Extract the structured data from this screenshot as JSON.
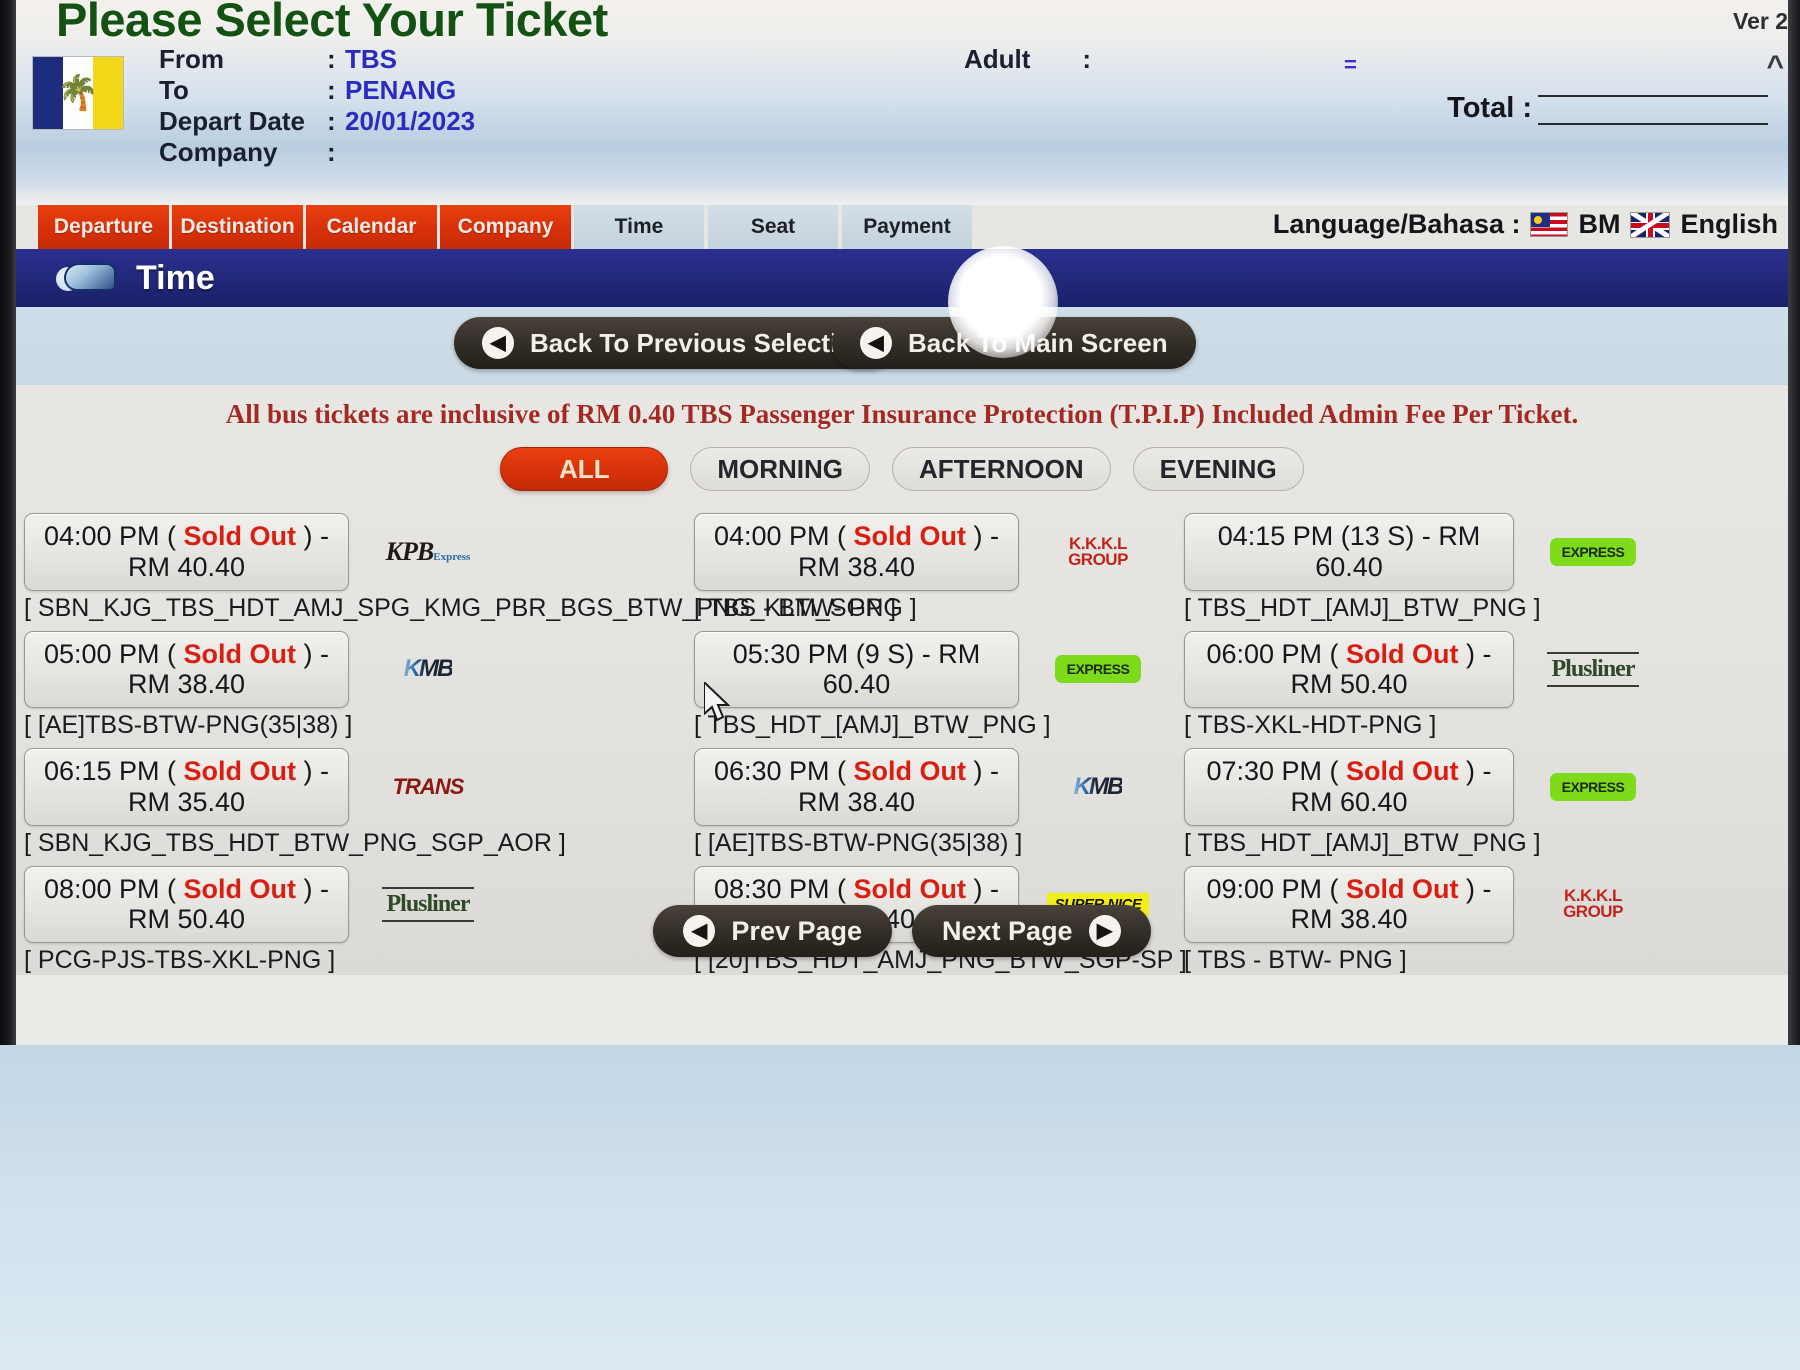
{
  "header": {
    "page_title": "Please Select Your Ticket",
    "version": "Ver 2",
    "fields": [
      {
        "label": "From",
        "colon": ":",
        "value": "TBS"
      },
      {
        "label": "To",
        "colon": ":",
        "value": "PENANG"
      },
      {
        "label": "Depart Date",
        "colon": ":",
        "value": "20/01/2023"
      },
      {
        "label": "Company",
        "colon": ":",
        "value": ""
      }
    ],
    "adult_label": "Adult",
    "adult_colon": ":",
    "adult_value": "=",
    "total_label": "Total :",
    "total_value": ""
  },
  "tabs": [
    {
      "label": "Departure",
      "state": "done"
    },
    {
      "label": "Destination",
      "state": "done"
    },
    {
      "label": "Calendar",
      "state": "done"
    },
    {
      "label": "Company",
      "state": "done"
    },
    {
      "label": "Time",
      "state": "pending"
    },
    {
      "label": "Seat",
      "state": "pending"
    },
    {
      "label": "Payment",
      "state": "pending"
    }
  ],
  "language": {
    "label": "Language/Bahasa :",
    "bm_label": "BM",
    "english_label": "English"
  },
  "section": {
    "title": "Time",
    "icon": "bus-icon"
  },
  "nav_buttons": {
    "back_previous": "Back To Previous Selection",
    "back_main": "Back To Main Screen"
  },
  "notice": "All bus tickets are inclusive of RM 0.40 TBS Passenger Insurance Protection (T.P.I.P) Included Admin Fee Per Ticket.",
  "filters": [
    {
      "label": "ALL",
      "active": true
    },
    {
      "label": "MORNING",
      "active": false
    },
    {
      "label": "AFTERNOON",
      "active": false
    },
    {
      "label": "EVENING",
      "active": false
    }
  ],
  "trip_columns": [
    {
      "trips": [
        {
          "time": "04:00 PM",
          "status": "Sold Out",
          "sold_out": true,
          "currency": "RM",
          "price": "40.40",
          "route": "[ SBN_KJG_TBS_HDT_AMJ_SPG_KMG_PBR_BGS_BTW_PNG_KLM_SGP ]",
          "operator": "KPB Express",
          "logo": "kpb"
        },
        {
          "time": "05:00 PM",
          "status": "Sold Out",
          "sold_out": true,
          "currency": "RM",
          "price": "38.40",
          "route": "[ [AE]TBS-BTW-PNG(35|38) ]",
          "operator": "KMB",
          "logo": "kmb"
        },
        {
          "time": "06:15 PM",
          "status": "Sold Out",
          "sold_out": true,
          "currency": "RM",
          "price": "35.40",
          "route": "[ SBN_KJG_TBS_HDT_BTW_PNG_SGP_AOR ]",
          "operator": "Transnasional Express",
          "logo": "trans"
        },
        {
          "time": "08:00 PM",
          "status": "Sold Out",
          "sold_out": true,
          "currency": "RM",
          "price": "50.40",
          "route": "[ PCG-PJS-TBS-XKL-PNG ]",
          "operator": "Plusliner",
          "logo": "plusliner"
        }
      ]
    },
    {
      "trips": [
        {
          "time": "04:00 PM",
          "status": "Sold Out",
          "sold_out": true,
          "currency": "RM",
          "price": "38.40",
          "route": "[ TBS - BTW- PNG ]",
          "operator": "K.K.K.L Group",
          "logo": "kkkl"
        },
        {
          "time": "05:30 PM",
          "status": "9 S",
          "sold_out": false,
          "currency": "RM",
          "price": "60.40",
          "route": "[ TBS_HDT_[AMJ]_BTW_PNG ]",
          "operator": "Green Express",
          "logo": "green"
        },
        {
          "time": "06:30 PM",
          "status": "Sold Out",
          "sold_out": true,
          "currency": "RM",
          "price": "38.40",
          "route": "[ [AE]TBS-BTW-PNG(35|38) ]",
          "operator": "KMB",
          "logo": "kmb"
        },
        {
          "time": "08:30 PM",
          "status": "Sold Out",
          "sold_out": true,
          "currency": "RM",
          "price": "53.40",
          "route": "[ [20]TBS_HDT_AMJ_PNG_BTW_SGP-SP ]",
          "operator": "Super Nice",
          "logo": "supernice"
        }
      ]
    },
    {
      "trips": [
        {
          "time": "04:15 PM",
          "status": "13 S",
          "sold_out": false,
          "currency": "RM",
          "price": "60.40",
          "route": "[ TBS_HDT_[AMJ]_BTW_PNG ]",
          "operator": "Green Express",
          "logo": "green"
        },
        {
          "time": "06:00 PM",
          "status": "Sold Out",
          "sold_out": true,
          "currency": "RM",
          "price": "50.40",
          "route": "[ TBS-XKL-HDT-PNG ]",
          "operator": "Plusliner",
          "logo": "plusliner"
        },
        {
          "time": "07:30 PM",
          "status": "Sold Out",
          "sold_out": true,
          "currency": "RM",
          "price": "60.40",
          "route": "[ TBS_HDT_[AMJ]_BTW_PNG ]",
          "operator": "Green Express",
          "logo": "green"
        },
        {
          "time": "09:00 PM",
          "status": "Sold Out",
          "sold_out": true,
          "currency": "RM",
          "price": "38.40",
          "route": "[ TBS - BTW- PNG ]",
          "operator": "K.K.K.L Group",
          "logo": "kkkl"
        }
      ]
    }
  ],
  "pagination": {
    "prev_label": "Prev Page",
    "next_label": "Next Page"
  },
  "logo_text": {
    "kpb": "KPB",
    "kpb_sub": "Express",
    "kmb": "KMB",
    "trans": "TRANS",
    "plusliner": "Plusliner",
    "kkkl_line1": "K.K.K.L",
    "kkkl_line2": "GROUP",
    "green": "EXPRESS",
    "supernice": "SUPER NICE"
  },
  "colors": {
    "tab_active": "#d8300a",
    "filter_active": "#d6310b",
    "sold_out": "#d81f12",
    "notice": "#a32a22",
    "section_bar": "#232a7d",
    "title_green": "#145214",
    "value_blue": "#2b2bbf"
  }
}
